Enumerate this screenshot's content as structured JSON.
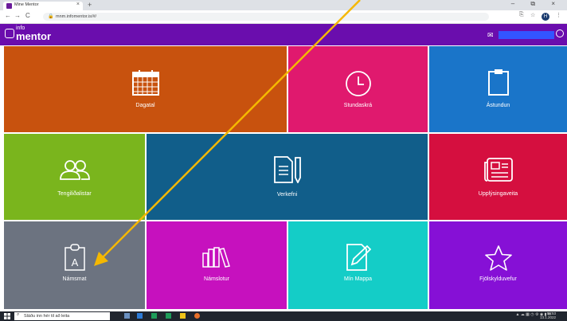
{
  "browser": {
    "tab_title": "Mine Mentor",
    "tab_close": "×",
    "new_tab": "+",
    "window_controls": "– ⧉ ×",
    "url": "mnm.infomentor.is/#/",
    "back": "←",
    "forward": "→",
    "reload": "C",
    "profile_initial": "H"
  },
  "header": {
    "logo_info": "info",
    "logo_mentor": "mentor",
    "accent": "#6a0dad"
  },
  "tiles": [
    {
      "key": "dagatal",
      "label": "Dagatal",
      "icon": "calendar-icon",
      "color": "#c8520e"
    },
    {
      "key": "stundaskra",
      "label": "Stundaskrá",
      "icon": "clock-icon",
      "color": "#e0196e"
    },
    {
      "key": "astundun",
      "label": "Ástundun",
      "icon": "clipboard-icon",
      "color": "#1a75c9"
    },
    {
      "key": "tengilidalistar",
      "label": "Tengiliðalistar",
      "icon": "people-icon",
      "color": "#7ab51d"
    },
    {
      "key": "verkefni",
      "label": "Verkefni",
      "icon": "document-pencil-icon",
      "color": "#115e8a"
    },
    {
      "key": "upplysingaveita",
      "label": "Upplýsingaveita",
      "icon": "newspaper-icon",
      "color": "#d50f3f"
    },
    {
      "key": "namsmat",
      "label": "Námsmat",
      "icon": "assessment-icon",
      "color": "#6c7380"
    },
    {
      "key": "namslotur",
      "label": "Námslotur",
      "icon": "books-icon",
      "color": "#c611be"
    },
    {
      "key": "min_mappa",
      "label": "Mín Mappa",
      "icon": "edit-folder-icon",
      "color": "#14cdc7"
    },
    {
      "key": "fjolskylduvefur",
      "label": "Fjölskylduvefur",
      "icon": "star-icon",
      "color": "#8610d6"
    }
  ],
  "taskbar": {
    "search_placeholder": "Sláðu inn hér til að leita",
    "time": "08:53",
    "date": "13.1.2022"
  },
  "annotation": {
    "arrow_color": "#f5b800"
  }
}
